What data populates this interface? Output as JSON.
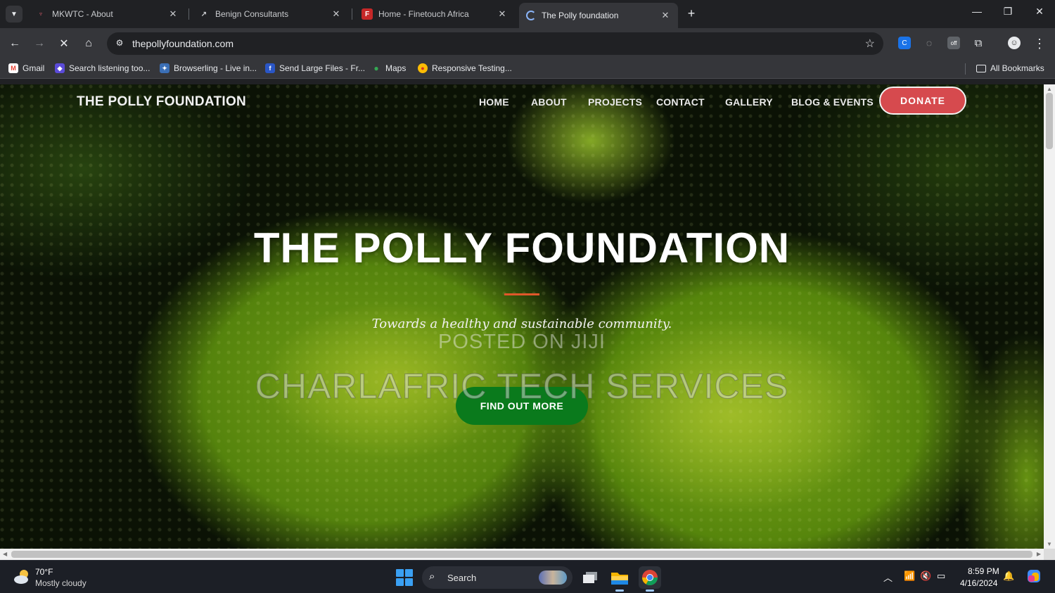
{
  "browser": {
    "tabs": [
      {
        "title": "MKWTC - About",
        "icon": "mkwtc-favicon",
        "active": false
      },
      {
        "title": "Benign Consultants",
        "icon": "benign-favicon",
        "active": false
      },
      {
        "title": "Home - Finetouch Africa",
        "icon": "finetouch-favicon",
        "active": false
      },
      {
        "title": "The Polly foundation",
        "icon": "loading-favicon",
        "active": true
      }
    ],
    "url": "thepollyfoundation.com",
    "bookmarks": [
      {
        "label": "Gmail",
        "icon": "gmail-icon"
      },
      {
        "label": "Search listening too...",
        "icon": "search-listening-icon"
      },
      {
        "label": "Browserling - Live in...",
        "icon": "browserling-icon"
      },
      {
        "label": "Send Large Files - Fr...",
        "icon": "send-files-icon"
      },
      {
        "label": "Maps",
        "icon": "maps-icon"
      },
      {
        "label": "Responsive Testing...",
        "icon": "responsive-testing-icon"
      }
    ],
    "all_bookmarks_label": "All Bookmarks"
  },
  "site": {
    "brand": "THE POLLY FOUNDATION",
    "nav": [
      "HOME",
      "ABOUT",
      "PROJECTS",
      "CONTACT",
      "GALLERY",
      "BLOG & EVENTS"
    ],
    "donate_label": "DONATE",
    "hero": {
      "title": "THE POLLY FOUNDATION",
      "subtitle": "Towards a healthy and sustainable community.",
      "cta_label": "FIND OUT MORE"
    },
    "watermark": {
      "line1": "POSTED ON JIJI",
      "line2": "CHARLAFRIC TECH SERVICES"
    },
    "colors": {
      "donate": "#d64a4e",
      "cta": "#0a7a1c",
      "divider": "#e0572a"
    }
  },
  "taskbar": {
    "weather_temp": "70°F",
    "weather_desc": "Mostly cloudy",
    "search_label": "Search",
    "time": "8:59 PM",
    "date": "4/16/2024"
  }
}
